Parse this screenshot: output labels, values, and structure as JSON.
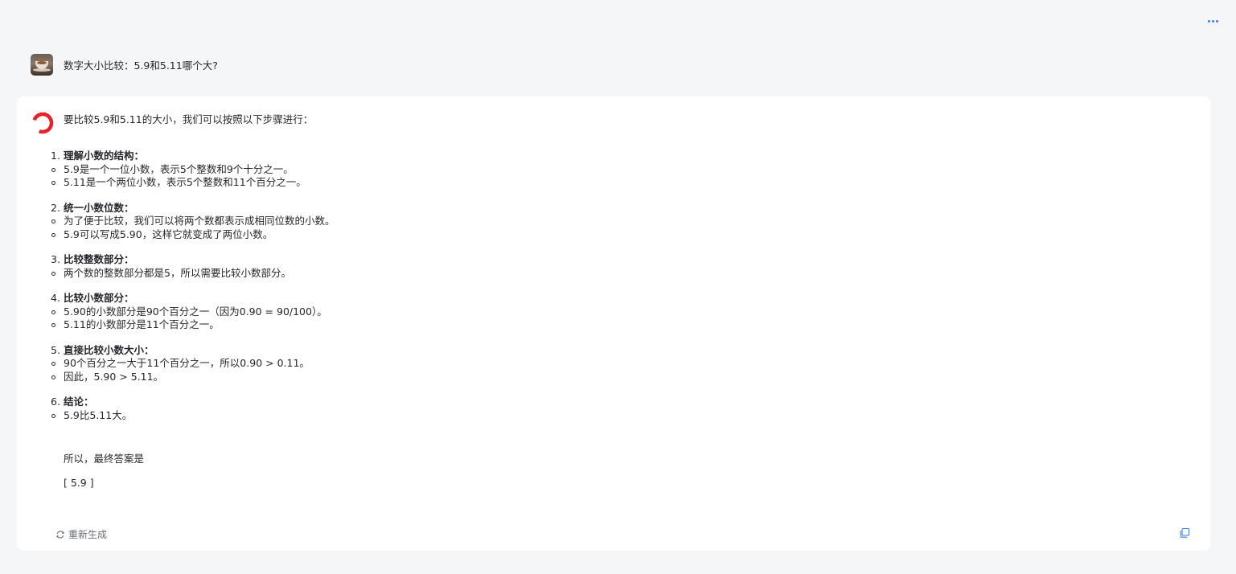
{
  "header": {
    "more_icon": "more-dots-icon"
  },
  "user_message": {
    "avatar": "coffee-avatar",
    "text": "数字大小比较：5.9和5.11哪个大?"
  },
  "assistant": {
    "avatar": "brand-ring-logo",
    "intro": "要比较5.9和5.11的大小，我们可以按照以下步骤进行：",
    "steps": [
      {
        "num": "1.",
        "title": "理解小数的结构：",
        "bullets": [
          "5.9是一个一位小数，表示5个整数和9个十分之一。",
          "5.11是一个两位小数，表示5个整数和11个百分之一。"
        ]
      },
      {
        "num": "2.",
        "title": "统一小数位数：",
        "bullets": [
          "为了便于比较，我们可以将两个数都表示成相同位数的小数。",
          "5.9可以写成5.90，这样它就变成了两位小数。"
        ]
      },
      {
        "num": "3.",
        "title": "比较整数部分：",
        "bullets": [
          "两个数的整数部分都是5，所以需要比较小数部分。"
        ]
      },
      {
        "num": "4.",
        "title": "比较小数部分：",
        "bullets": [
          "5.90的小数部分是90个百分之一（因为0.90 = 90/100）。",
          "5.11的小数部分是11个百分之一。"
        ]
      },
      {
        "num": "5.",
        "title": "直接比较小数大小：",
        "bullets": [
          "90个百分之一大于11个百分之一，所以0.90 > 0.11。",
          "因此，5.90 > 5.11。"
        ]
      },
      {
        "num": "6.",
        "title": "结论：",
        "bullets": [
          "5.9比5.11大。"
        ]
      }
    ],
    "conclusion": "所以，最终答案是",
    "answer": "[ 5.9 ]",
    "regenerate_label": "重新生成",
    "colors": {
      "brand": "#e8202a",
      "accent": "#3a7ef0"
    }
  }
}
